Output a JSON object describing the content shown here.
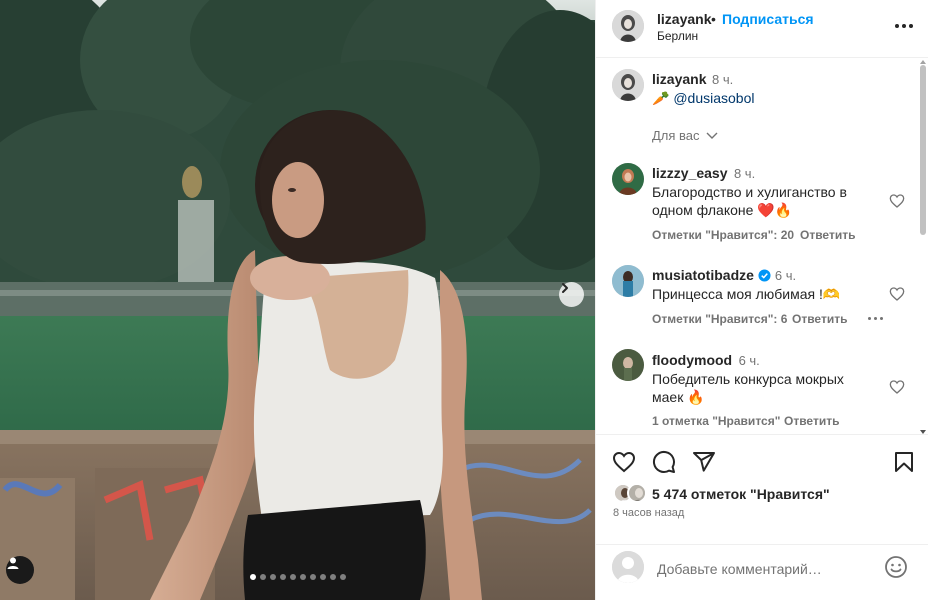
{
  "post": {
    "carousel_total": 10,
    "carousel_active": 0
  },
  "header": {
    "username": "lizayank",
    "separator": "•",
    "follow_label": "Подписаться",
    "location": "Берлин"
  },
  "caption": {
    "username": "lizayank",
    "time": "8 ч.",
    "emoji": "🥕",
    "mention": "@dusiasobol",
    "for_you": "Для вас"
  },
  "comments": [
    {
      "username": "lizzzy_easy",
      "time": "8 ч.",
      "text_line1": "Благородство и хулиганство в",
      "text_line2": "одном флаконе ❤️🔥",
      "likes": "Отметки \"Нравится\": 20",
      "reply": "Ответить",
      "verified": false
    },
    {
      "username": "musiatotibadze",
      "time": "6 ч.",
      "text_line1": "Принцесса моя любимая !🫶",
      "text_line2": "",
      "likes": "Отметки \"Нравится\": 6",
      "reply": "Ответить",
      "verified": true
    },
    {
      "username": "floodymood",
      "time": "6 ч.",
      "text_line1": "Победитель конкурса мокрых",
      "text_line2": "маек 🔥",
      "likes": "1 отметка \"Нравится\"",
      "reply": "Ответить",
      "verified": false
    }
  ],
  "stats": {
    "likes_text": "5 474 отметок \"Нравится\"",
    "posted_ago": "8 часов назад"
  },
  "comment_box": {
    "placeholder": "Добавьте комментарий…"
  },
  "icons": {
    "heart": "heart-icon",
    "comment": "comment-icon",
    "share": "share-icon",
    "save": "bookmark-icon",
    "emoji": "emoji-icon",
    "more": "more-icon",
    "next": "chevron-right-icon",
    "tag": "user-tag-icon"
  },
  "colors": {
    "link_blue": "#0095f6",
    "text": "#262626",
    "muted": "#737373",
    "verified": "#0095f6"
  }
}
